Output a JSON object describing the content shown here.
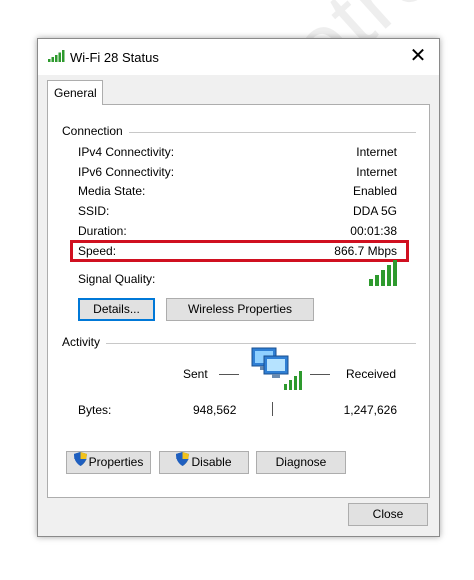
{
  "window": {
    "title": "Wi-Fi 28 Status",
    "close_glyph": "✕"
  },
  "tabs": [
    {
      "label": "General"
    }
  ],
  "connection": {
    "heading": "Connection",
    "rows": [
      {
        "label": "IPv4 Connectivity:",
        "value": "Internet"
      },
      {
        "label": "IPv6 Connectivity:",
        "value": "Internet"
      },
      {
        "label": "Media State:",
        "value": "Enabled"
      },
      {
        "label": "SSID:",
        "value": "DDA 5G"
      },
      {
        "label": "Duration:",
        "value": "00:01:38"
      },
      {
        "label": "Speed:",
        "value": "866.7 Mbps"
      }
    ],
    "signal_label": "Signal Quality:",
    "signal_bars_filled": 5,
    "signal_icon": "signal-bars-icon",
    "buttons": {
      "details": "Details...",
      "wireless": "Wireless Properties"
    }
  },
  "activity": {
    "heading": "Activity",
    "sent_label": "Sent",
    "received_label": "Received",
    "bytes_label": "Bytes:",
    "bytes_sent": "948,562",
    "bytes_received": "1,247,626",
    "network_icon": "network-computers-icon"
  },
  "actions": {
    "properties": "Properties",
    "disable": "Disable",
    "diagnose": "Diagnose"
  },
  "footer": {
    "close": "Close"
  },
  "watermark": "DiegoEletro",
  "colors": {
    "highlight_border": "#d01020",
    "signal_green": "#2e9a2e",
    "focus_blue": "#0078d7"
  }
}
